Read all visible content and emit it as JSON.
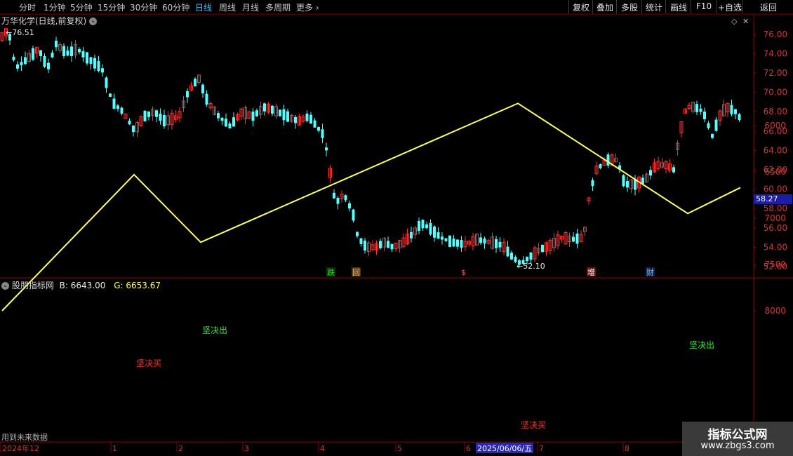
{
  "toolbar": {
    "left": [
      {
        "label": "分时",
        "active": false
      },
      {
        "label": "1分钟",
        "active": false
      },
      {
        "label": "5分钟",
        "active": false
      },
      {
        "label": "15分钟",
        "active": false
      },
      {
        "label": "30分钟",
        "active": false
      },
      {
        "label": "60分钟",
        "active": false
      },
      {
        "label": "日线",
        "active": true
      },
      {
        "label": "周线",
        "active": false
      },
      {
        "label": "月线",
        "active": false
      },
      {
        "label": "多周期",
        "active": false
      },
      {
        "label": "更多 ›",
        "active": false
      }
    ],
    "right": [
      "复权",
      "叠加",
      "多股",
      "统计",
      "画线",
      "F10",
      "+自选",
      "返回"
    ]
  },
  "main": {
    "title": "万华化学(日线,前复权)",
    "high_label": "76.51",
    "low_label": "52.10",
    "current_price": "58.27",
    "y_ticks": [
      "76.00",
      "74.00",
      "72.00",
      "70.00",
      "68.00",
      "66.00",
      "64.00",
      "62.00",
      "60.00",
      "58.00",
      "56.00",
      "54.00",
      "52.00"
    ],
    "event_markers": [
      {
        "text": "跌",
        "color": "#22dd22",
        "bg": "#003300"
      },
      {
        "text": "回",
        "color": "#ffcc66",
        "bg": "#553300"
      },
      {
        "text": "$",
        "color": "#ff4444",
        "bg": "#000"
      },
      {
        "text": "增",
        "color": "#ffffff",
        "bg": "#661111"
      },
      {
        "text": "财",
        "color": "#66bbff",
        "bg": "#112244"
      }
    ]
  },
  "indicator": {
    "name": "股朋指标网",
    "b_label": "B: 6643.00",
    "g_label": "G: 6653.67",
    "y_ticks": [
      "8000",
      "7500",
      "7000",
      "6500",
      "6000"
    ],
    "annotations": [
      {
        "text": "坚决买",
        "color": "#ff3333"
      },
      {
        "text": "坚决出",
        "color": "#33ee33"
      },
      {
        "text": "坚决买",
        "color": "#ff3333"
      },
      {
        "text": "坚决出",
        "color": "#33ee33"
      }
    ],
    "note": "用到未来数据"
  },
  "x_axis": {
    "labels": [
      "2024年12",
      "1",
      "2",
      "3",
      "4",
      "5",
      "6",
      "2025/06/06/五",
      "7",
      "8"
    ]
  },
  "watermark": {
    "line1": "指标公式网",
    "line2": "www.zbgs3.com"
  },
  "colors": {
    "up": "#ff3232",
    "down": "#54ffff",
    "line": "#ffff66",
    "axis": "#8b0000"
  }
}
